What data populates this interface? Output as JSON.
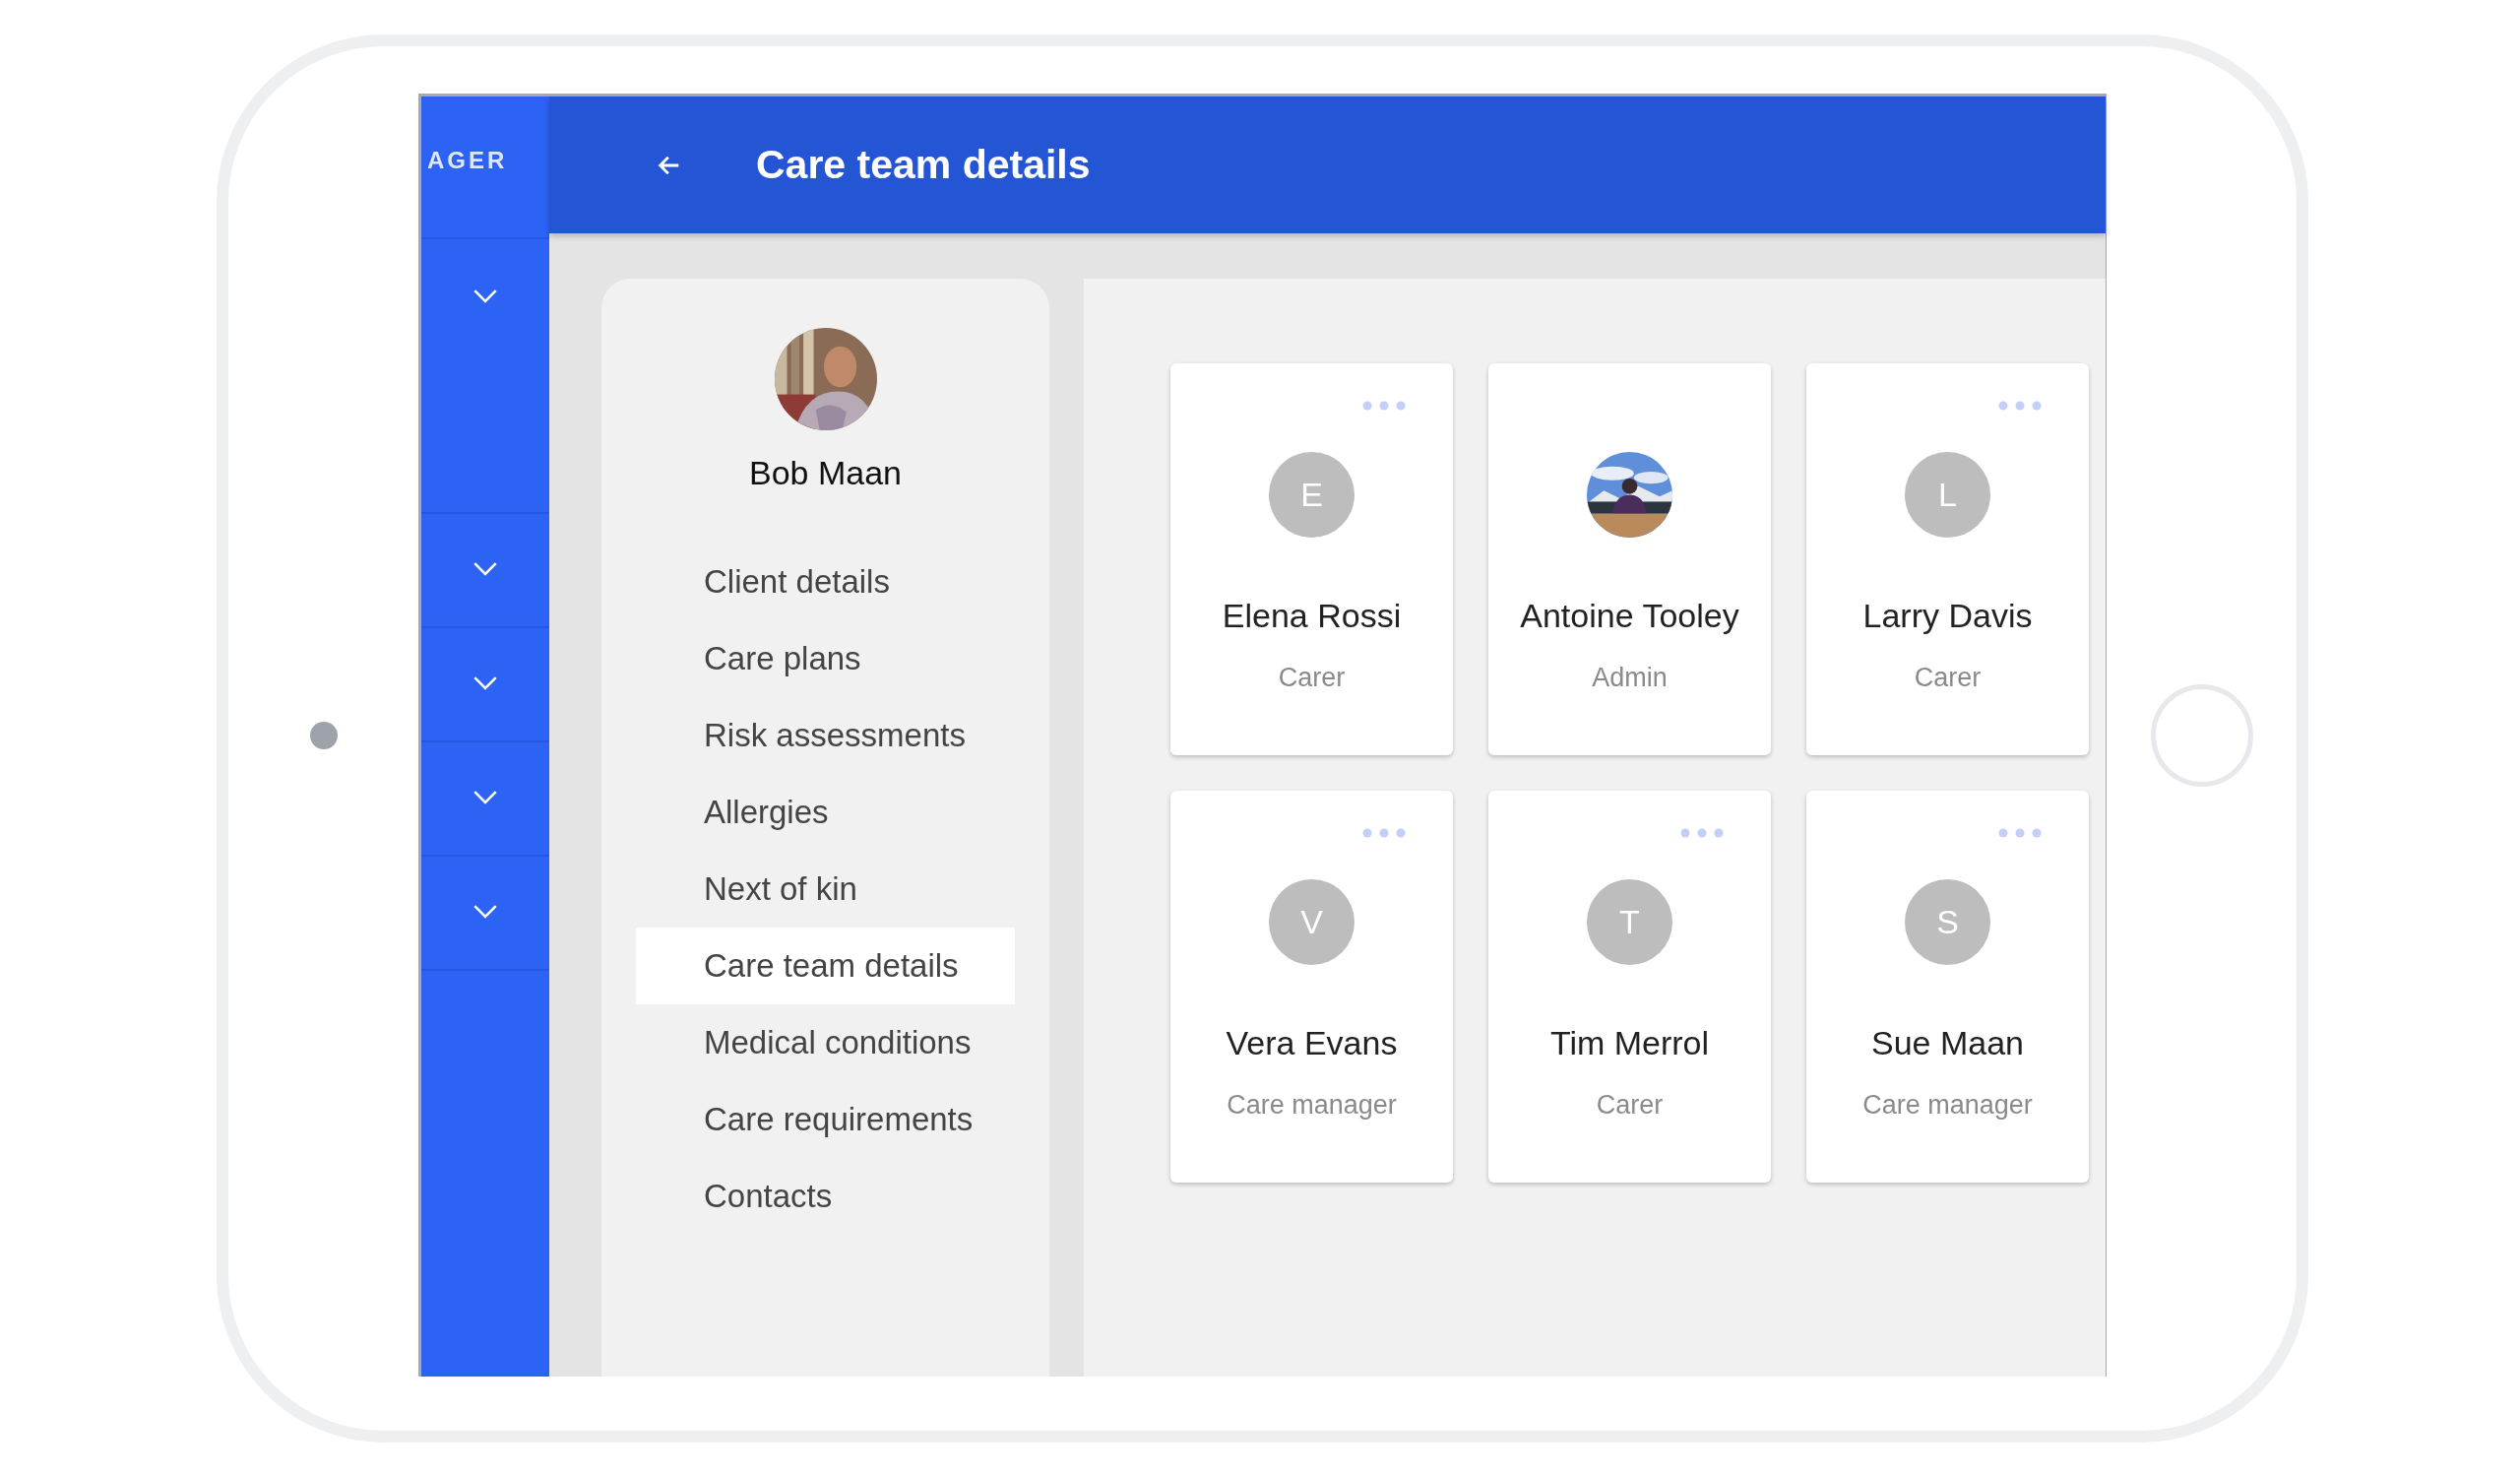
{
  "rail": {
    "label": "AGER",
    "sections": [
      {
        "expanded": false
      },
      {
        "expanded": false
      },
      {
        "expanded": false
      },
      {
        "expanded": false
      },
      {
        "expanded": false
      }
    ]
  },
  "header": {
    "title": "Care team details"
  },
  "client": {
    "name": "Bob Maan"
  },
  "menu": [
    {
      "label": "Client details",
      "selected": false
    },
    {
      "label": "Care plans",
      "selected": false
    },
    {
      "label": "Risk assessments",
      "selected": false
    },
    {
      "label": "Allergies",
      "selected": false
    },
    {
      "label": "Next of kin",
      "selected": false
    },
    {
      "label": "Care team details",
      "selected": true
    },
    {
      "label": "Medical conditions",
      "selected": false
    },
    {
      "label": "Care requirements",
      "selected": false
    },
    {
      "label": "Contacts",
      "selected": false
    }
  ],
  "team": [
    {
      "name": "Elena Rossi",
      "role": "Carer",
      "avatar": {
        "kind": "initial",
        "initial": "E"
      },
      "menu": true
    },
    {
      "name": "Antoine Tooley",
      "role": "Admin",
      "menu": false
    },
    {
      "name": "Larry Davis",
      "role": "Carer",
      "avatar": {
        "kind": "initial",
        "initial": "L"
      },
      "menu": true
    },
    {
      "name": "Vera Evans",
      "role": "Care manager",
      "avatar": {
        "kind": "initial",
        "initial": "V"
      },
      "menu": true
    },
    {
      "name": "Tim Merrol",
      "role": "Carer",
      "avatar": {
        "kind": "initial",
        "initial": "T"
      },
      "menu": true
    },
    {
      "name": "Sue Maan",
      "role": "Care manager",
      "avatar": {
        "kind": "initial",
        "initial": "S"
      },
      "menu": true
    }
  ]
}
